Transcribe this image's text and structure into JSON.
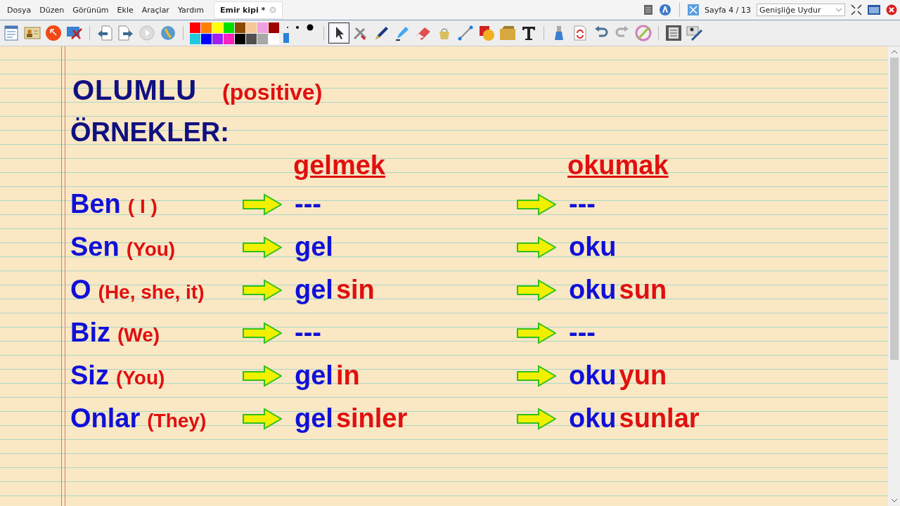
{
  "menu": [
    "Dosya",
    "Düzen",
    "Görünüm",
    "Ekle",
    "Araçlar",
    "Yardım"
  ],
  "tab": {
    "label": "Emir kipi *",
    "selected": true
  },
  "swatches": [
    {
      "color": "#ff0000"
    },
    {
      "color": "#ff8000"
    },
    {
      "color": "#ffff00"
    },
    {
      "color": "#00e000"
    },
    {
      "color": "#8b4a00"
    },
    {
      "color": "#f5c896"
    },
    {
      "color": "#f0a0e0"
    },
    {
      "color": "#a00000"
    },
    {
      "color": "#20c8e0"
    },
    {
      "color": "#0000ff"
    },
    {
      "color": "#a020f0"
    },
    {
      "color": "#ff20c0"
    },
    {
      "color": "#000000"
    },
    {
      "color": "#505050"
    },
    {
      "color": "#a8a8a8"
    },
    {
      "color": "#ffffff"
    }
  ],
  "page_indicator": "Sayfa 4 / 13",
  "zoom_select": {
    "value": "Genişliğe Uydur"
  },
  "content": {
    "title": "OLUMLU",
    "title_note": "(positive)",
    "subtitle": "ÖRNEKLER:",
    "headers": [
      "gelmek",
      "okumak"
    ],
    "rows": [
      {
        "pronoun": "Ben",
        "gloss": "( I )",
        "forms": [
          {
            "stem": "---"
          },
          {
            "stem": "---"
          }
        ]
      },
      {
        "pronoun": "Sen",
        "gloss": "(You)",
        "forms": [
          {
            "stem": "gel"
          },
          {
            "stem": "oku"
          }
        ]
      },
      {
        "pronoun": "O",
        "gloss": "(He, she, it)",
        "forms": [
          {
            "stem": "gel",
            "suffix": "sin"
          },
          {
            "stem": "oku",
            "suffix": "sun"
          }
        ]
      },
      {
        "pronoun": "Biz",
        "gloss": "(We)",
        "forms": [
          {
            "stem": "---"
          },
          {
            "stem": "---"
          }
        ]
      },
      {
        "pronoun": "Siz",
        "gloss": "(You)",
        "forms": [
          {
            "stem": "gel",
            "suffix": "in"
          },
          {
            "stem": "oku",
            "suffix": "yun"
          }
        ]
      },
      {
        "pronoun": "Onlar",
        "gloss": "(They)",
        "forms": [
          {
            "stem": "gel",
            "suffix": "sinler"
          },
          {
            "stem": "oku",
            "suffix": "sunlar"
          }
        ]
      }
    ]
  }
}
